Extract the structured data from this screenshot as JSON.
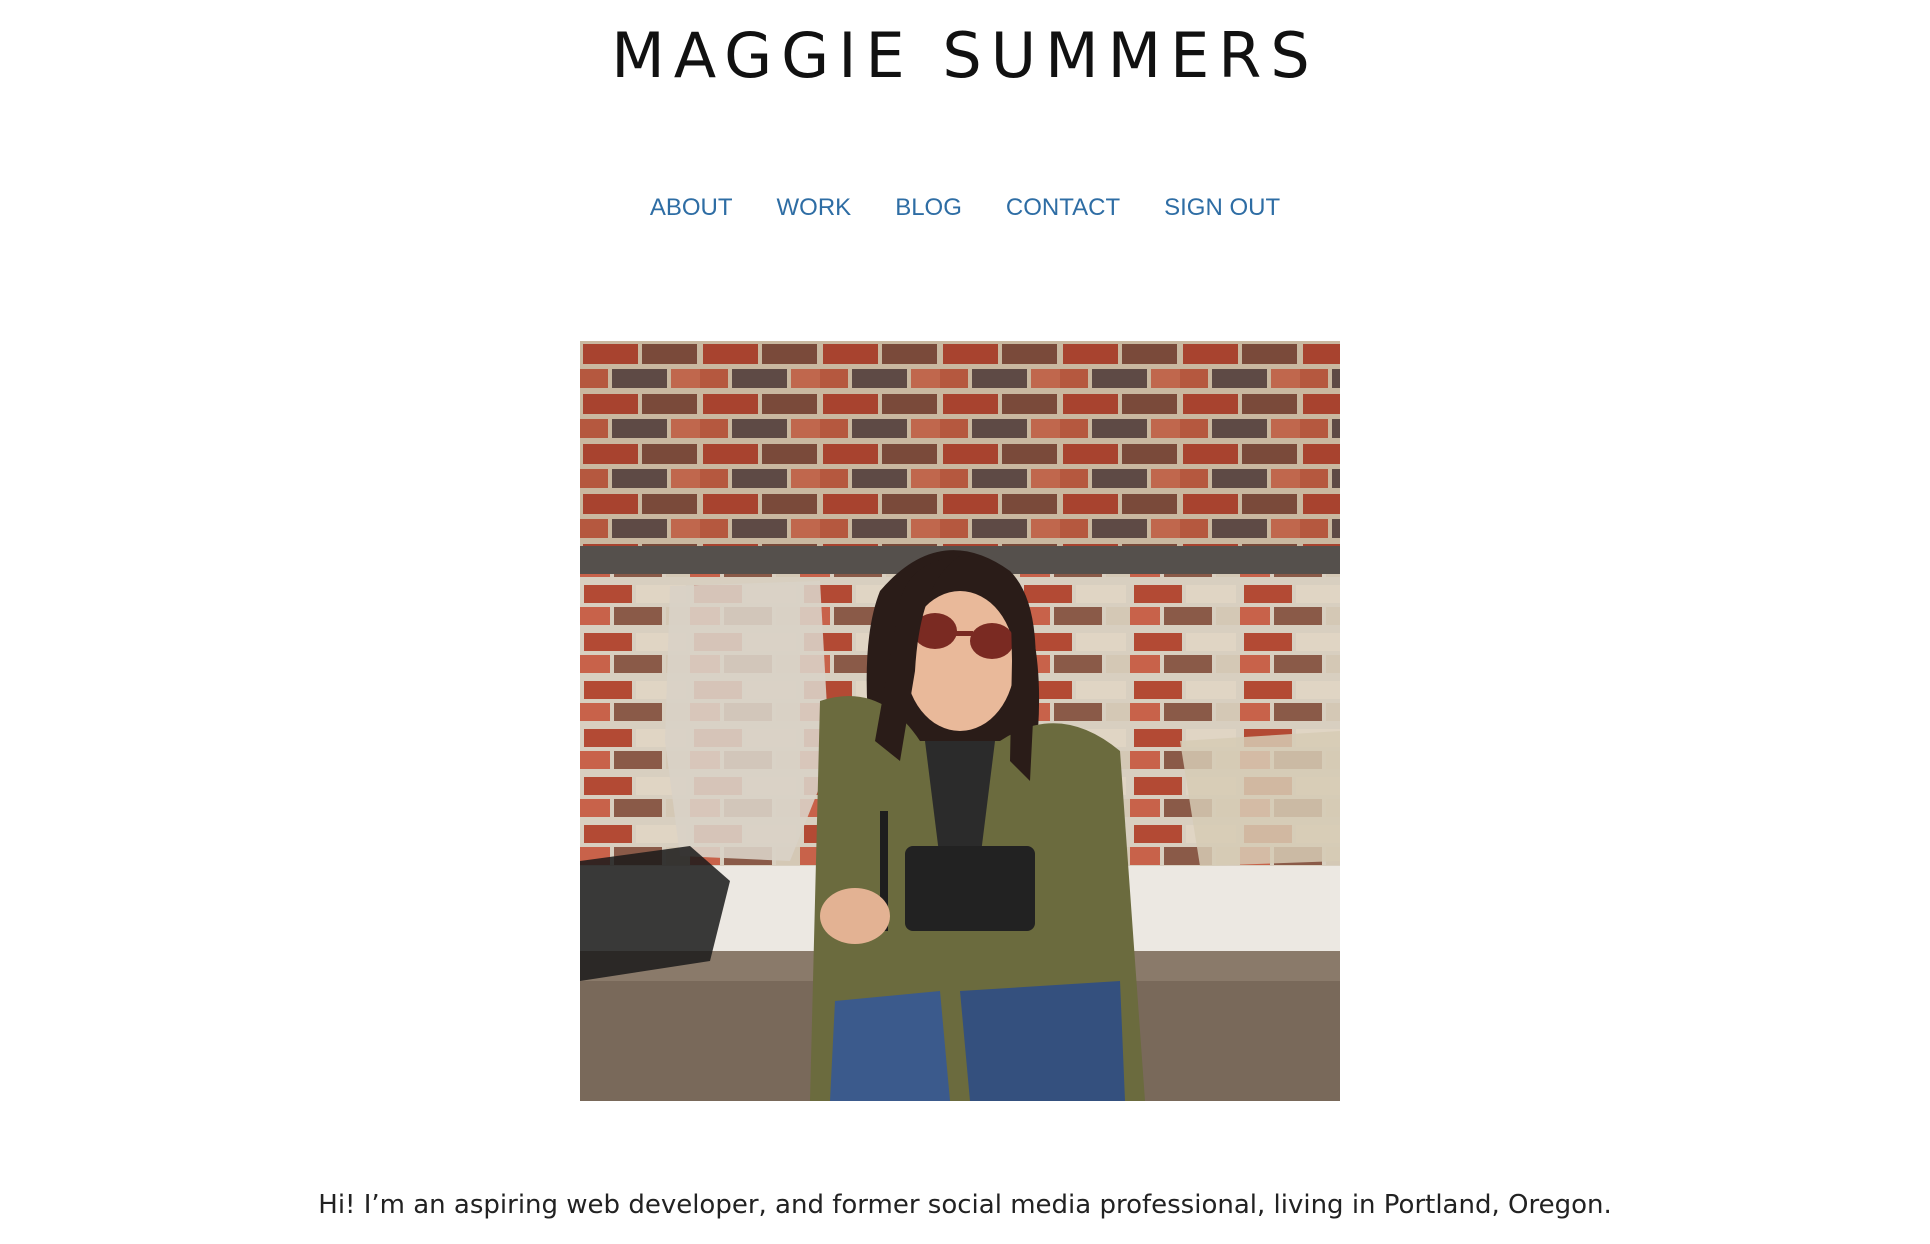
{
  "header": {
    "title": "MAGGIE SUMMERS"
  },
  "nav": {
    "items": [
      {
        "label": "ABOUT"
      },
      {
        "label": "WORK"
      },
      {
        "label": "BLOG"
      },
      {
        "label": "CONTACT"
      },
      {
        "label": "SIGN OUT"
      }
    ]
  },
  "main": {
    "intro": "Hi! I’m an aspiring web developer, and former social media professional, living in Portland, Oregon."
  },
  "colors": {
    "nav_link": "#2e6da4",
    "title": "#111111",
    "body_text": "#222222"
  }
}
